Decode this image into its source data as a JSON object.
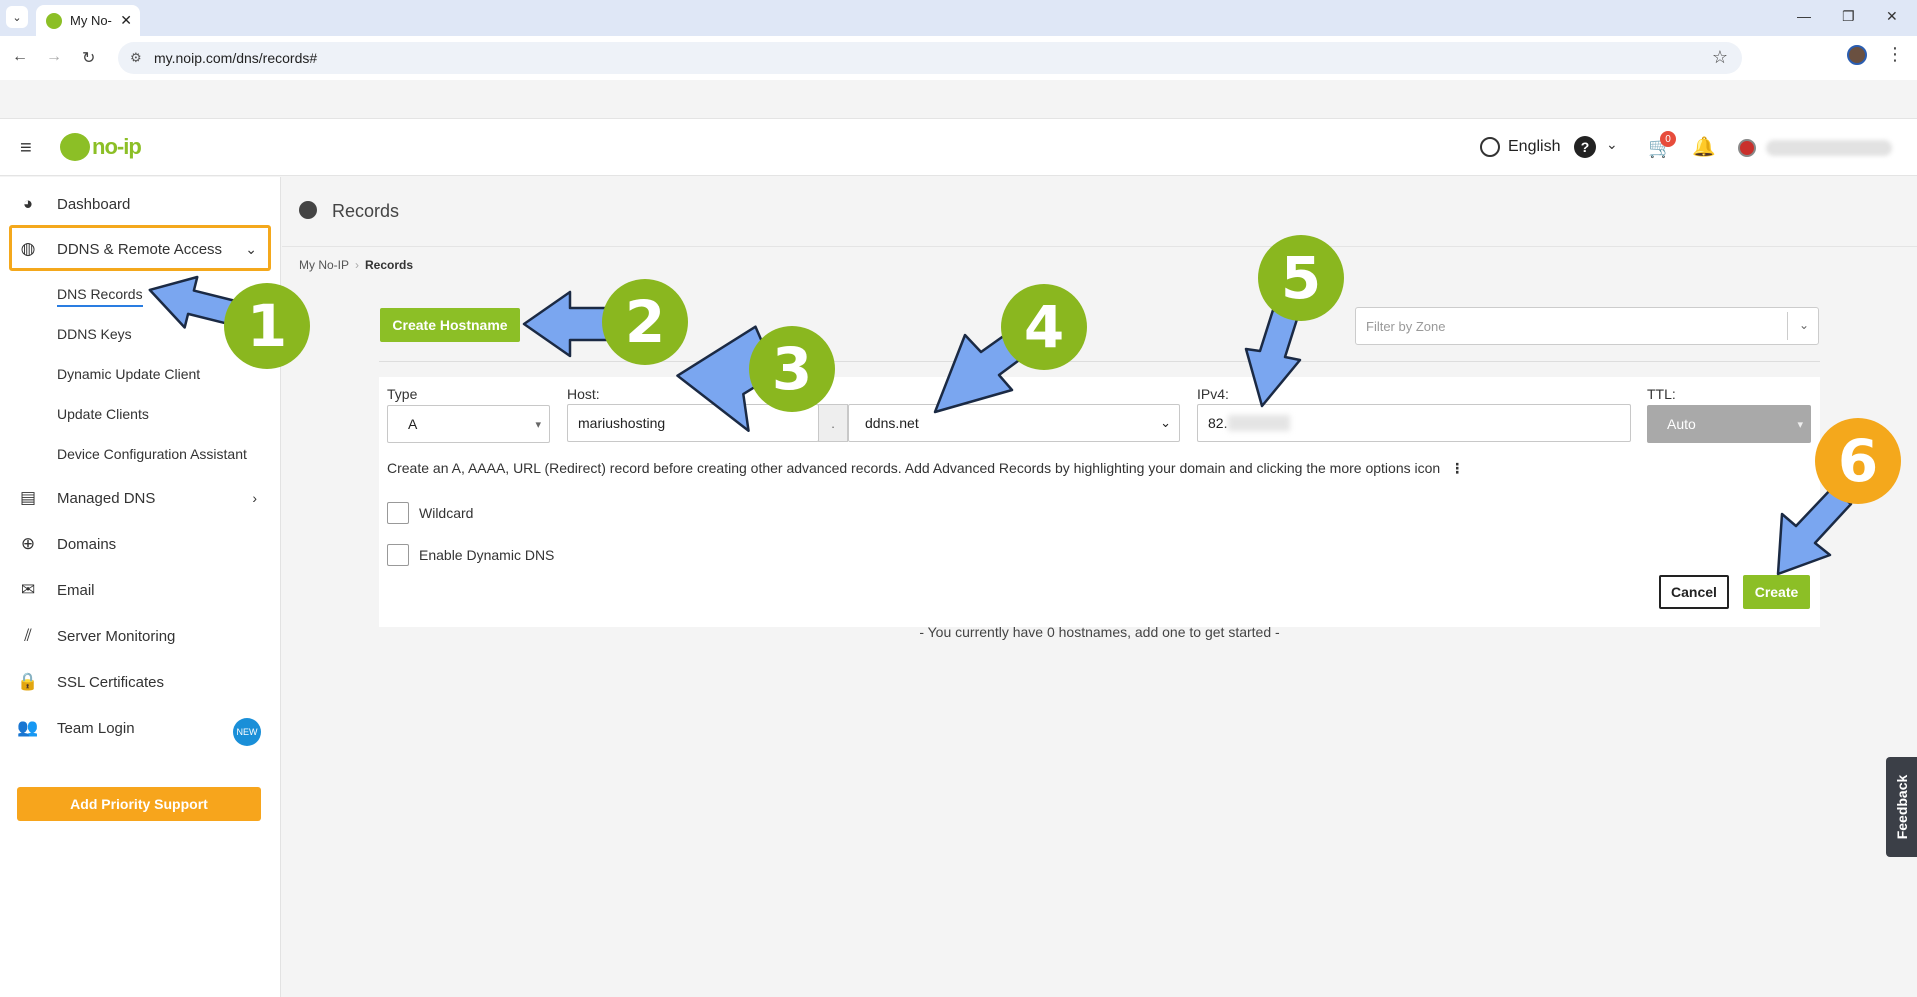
{
  "browser": {
    "tab_title": "My No-",
    "url": "my.noip.com/dns/records#"
  },
  "header": {
    "logo_text": "no-ip",
    "language": "English",
    "cart_count": "0"
  },
  "sidebar": {
    "items": [
      {
        "label": "Dashboard"
      },
      {
        "label": "DDNS & Remote Access"
      },
      {
        "label": "Managed DNS"
      },
      {
        "label": "Domains"
      },
      {
        "label": "Email"
      },
      {
        "label": "Server Monitoring"
      },
      {
        "label": "SSL Certificates"
      },
      {
        "label": "Team Login"
      }
    ],
    "sub_items": [
      "DNS Records",
      "DDNS Keys",
      "Dynamic Update Client",
      "Update Clients",
      "Device Configuration Assistant"
    ],
    "new_badge": "NEW",
    "priority_support": "Add Priority Support"
  },
  "main": {
    "page_title": "Records",
    "breadcrumb": [
      "My No-IP",
      "Records"
    ],
    "create_hostname": "Create Hostname",
    "filter_placeholder": "Filter by Zone",
    "form": {
      "type_label": "Type",
      "type_value": "A",
      "host_label": "Host:",
      "host_value": "mariushosting",
      "dot": ".",
      "domain_value": "ddns.net",
      "ipv4_label": "IPv4:",
      "ipv4_value": "82.",
      "ttl_label": "TTL:",
      "ttl_value": "Auto",
      "info_text": "Create an A, AAAA, URL (Redirect) record before creating other advanced records. Add Advanced Records by highlighting your domain and clicking the more options icon",
      "wildcard": "Wildcard",
      "dynamic_dns": "Enable Dynamic DNS",
      "cancel": "Cancel",
      "create": "Create"
    },
    "empty_message": "- You currently have 0 hostnames, add one to get started -",
    "feedback": "Feedback"
  },
  "annotations": {
    "steps": [
      "1",
      "2",
      "3",
      "4",
      "5",
      "6"
    ],
    "green": "#8ab71f",
    "orange": "#f4a81c",
    "arrow": "#7aa6f0"
  }
}
